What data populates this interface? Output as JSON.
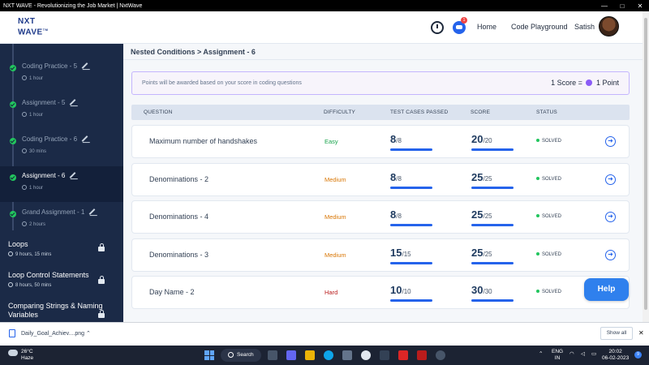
{
  "browser": {
    "title": "NXT WAVE - Revolutionizing the Job Market | NxtWave",
    "controls": [
      "—",
      "□",
      "✕"
    ]
  },
  "header": {
    "logo_line1": "NXT",
    "logo_line2": "WAVE",
    "logo_tm": "TM",
    "notification_count": "1",
    "nav": {
      "home": "Home",
      "code_playground": "Code Playground",
      "user": "Satish"
    }
  },
  "sidebar": {
    "items": [
      {
        "title": "Coding Practice - 5",
        "duration": "1 hour",
        "completed": true,
        "active": false
      },
      {
        "title": "Assignment - 5",
        "duration": "1 hour",
        "completed": true,
        "active": false
      },
      {
        "title": "Coding Practice - 6",
        "duration": "30 mins",
        "completed": true,
        "active": false
      },
      {
        "title": "Assignment - 6",
        "duration": "1 hour",
        "completed": true,
        "active": true
      },
      {
        "title": "Grand Assignment - 1",
        "duration": "2 hours",
        "completed": true,
        "active": false
      }
    ],
    "sections": [
      {
        "title": "Loops",
        "duration": "9 hours, 15 mins",
        "locked": true
      },
      {
        "title": "Loop Control Statements",
        "duration": "8 hours, 50 mins",
        "locked": true
      },
      {
        "title": "Comparing Strings & Naming Variables",
        "duration": "",
        "locked": true
      }
    ]
  },
  "main": {
    "breadcrumb": "Nested Conditions > Assignment - 6",
    "notice": "Points will be awarded based on your score in coding questions",
    "score_info": {
      "left": "1 Score =",
      "right": "1 Point"
    },
    "columns": [
      "QUESTION",
      "DIFFICULTY",
      "TEST CASES PASSED",
      "SCORE",
      "STATUS"
    ],
    "rows": [
      {
        "question": "Maximum number of handshakes",
        "difficulty": "Easy",
        "level": "easy",
        "passed": "8",
        "total": "/8",
        "score": "20",
        "max": "/20",
        "status": "SOLVED"
      },
      {
        "question": "Denominations - 2",
        "difficulty": "Medium",
        "level": "medium",
        "passed": "8",
        "total": "/8",
        "score": "25",
        "max": "/25",
        "status": "SOLVED"
      },
      {
        "question": "Denominations - 4",
        "difficulty": "Medium",
        "level": "medium",
        "passed": "8",
        "total": "/8",
        "score": "25",
        "max": "/25",
        "status": "SOLVED"
      },
      {
        "question": "Denominations - 3",
        "difficulty": "Medium",
        "level": "medium",
        "passed": "15",
        "total": "/15",
        "score": "25",
        "max": "/25",
        "status": "SOLVED"
      },
      {
        "question": "Day Name - 2",
        "difficulty": "Hard",
        "level": "hard",
        "passed": "10",
        "total": "/10",
        "score": "30",
        "max": "/30",
        "status": "SOLVED"
      }
    ],
    "help": "Help"
  },
  "downloads": {
    "file": "Daily_Goal_Achiev....png",
    "show_all": "Show all",
    "close": "✕"
  },
  "taskbar": {
    "temperature": "26°C",
    "weather": "Haze",
    "search": "Search",
    "lang1": "ENG",
    "lang2": "IN",
    "time": "20:02",
    "date": "06-02-2023",
    "notifications": "9"
  },
  "colors": {
    "sidebar_bg": "#1b2a47",
    "accent": "#2563eb",
    "easy": "#16a34a",
    "medium": "#d97706",
    "hard": "#b91c1c",
    "solved": "#22c55e"
  },
  "icons": [
    "timer-icon",
    "chat-icon",
    "pencil-icon",
    "clock-icon",
    "lock-icon",
    "arrow-right-icon",
    "check-icon"
  ]
}
